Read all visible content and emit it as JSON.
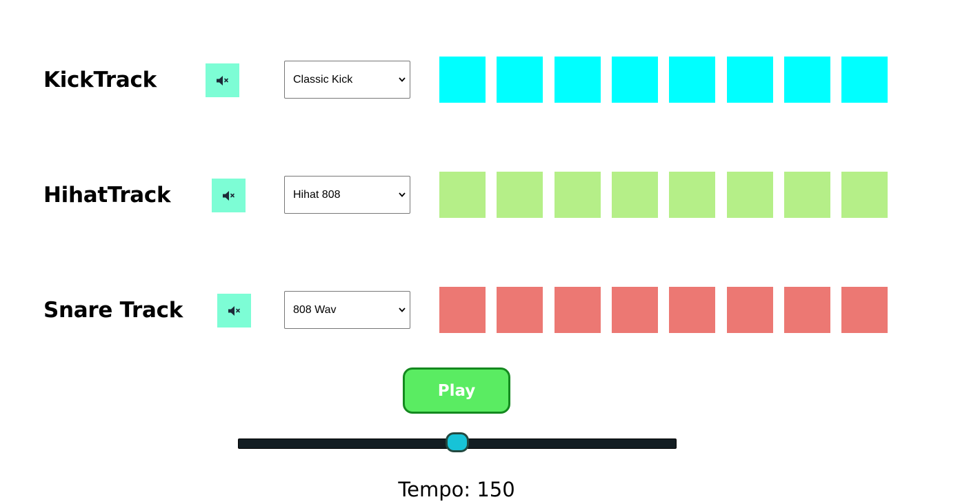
{
  "tracks": [
    {
      "title": "KickTrack",
      "mute_icon": "speaker-muted-icon",
      "sound_selected": "Classic Kick",
      "pad_color": "#00ffff",
      "pads_count": 8
    },
    {
      "title": "HihatTrack",
      "mute_icon": "speaker-muted-icon",
      "sound_selected": "Hihat 808",
      "pad_color": "#b5ef88",
      "pads_count": 8
    },
    {
      "title": "Snare Track",
      "mute_icon": "speaker-muted-icon",
      "sound_selected": "808 Wav",
      "pad_color": "#ec7873",
      "pads_count": 8
    }
  ],
  "controls": {
    "play_label": "Play",
    "tempo_text": "Tempo: 150",
    "tempo_fraction": 0.5
  },
  "colors": {
    "mute_button_bg": "#7dfdd5",
    "play_button_bg": "#5aec62",
    "play_button_border": "#14891f",
    "slider_track": "#131d22",
    "slider_thumb": "#17c3d7"
  }
}
